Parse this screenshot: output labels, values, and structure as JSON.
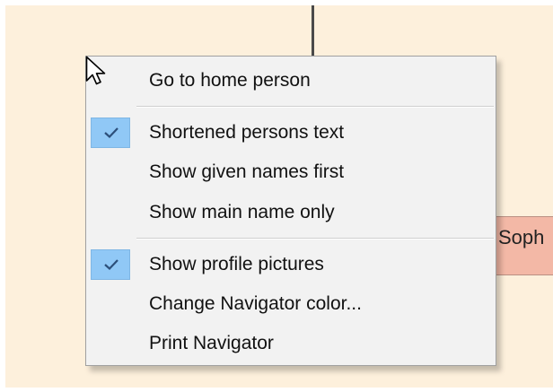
{
  "canvas": {
    "background": "#fdf0dc",
    "person_card": {
      "name": "Soph",
      "color": "#f3b8a6"
    }
  },
  "context_menu": {
    "items": [
      {
        "label": "Go to home person",
        "checked": false
      },
      {
        "label": "Shortened persons text",
        "checked": true
      },
      {
        "label": "Show given names first",
        "checked": false
      },
      {
        "label": "Show main name only",
        "checked": false
      },
      {
        "label": "Show profile pictures",
        "checked": true
      },
      {
        "label": "Change Navigator color...",
        "checked": false
      },
      {
        "label": "Print Navigator",
        "checked": false
      }
    ],
    "check_icon": "checkmark-icon",
    "check_color": "#90c8f6"
  },
  "cursor": {
    "icon": "arrow-pointer-icon"
  }
}
